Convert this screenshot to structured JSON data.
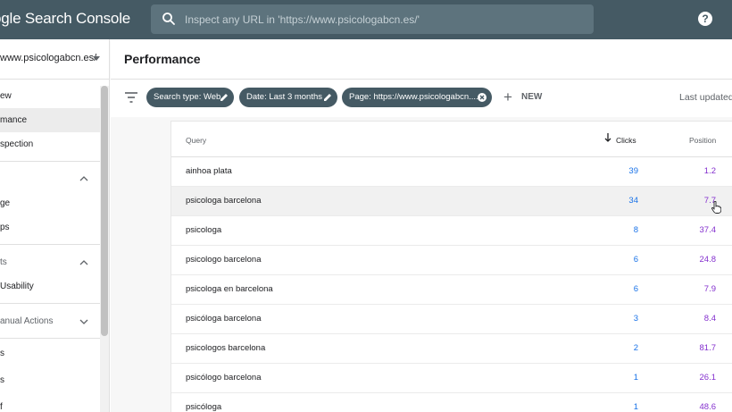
{
  "app": {
    "logo_text": "ogle Search Console",
    "search_placeholder": "Inspect any URL in 'https://www.psicologabcn.es/'",
    "help_label": "?"
  },
  "sidebar": {
    "property": "www.psicologabcn.es/",
    "items": [
      {
        "label": "ew",
        "active": false
      },
      {
        "label": "mance",
        "active": true
      },
      {
        "label": "spection",
        "active": false
      }
    ],
    "groups": [
      {
        "label": "",
        "chevron": "chevron-up-icon",
        "items": [
          "ge",
          "ps"
        ]
      },
      {
        "label": "ts",
        "chevron": "chevron-up-icon",
        "items": [
          "Usability"
        ]
      },
      {
        "label": "anual Actions",
        "chevron": "chevron-down-icon",
        "items": []
      }
    ],
    "extra_items": [
      "s",
      "s",
      "f"
    ]
  },
  "header": {
    "title": "Performance"
  },
  "filters": {
    "chips": [
      {
        "label": "Search type: Web",
        "icon": "pencil-icon"
      },
      {
        "label": "Date: Last 3 months",
        "icon": "pencil-icon"
      },
      {
        "label": "Page: https://www.psicologabcn....",
        "icon": "close-circle-icon"
      }
    ],
    "new_label": "NEW",
    "last_updated": "Last updated"
  },
  "table": {
    "columns": {
      "query": "Query",
      "clicks": "Clicks",
      "position": "Position"
    },
    "rows": [
      {
        "query": "ainhoa plata",
        "clicks": "39",
        "position": "1.2"
      },
      {
        "query": "psicologa barcelona",
        "clicks": "34",
        "position": "7.7"
      },
      {
        "query": "psicologa",
        "clicks": "8",
        "position": "37.4"
      },
      {
        "query": "psicologo barcelona",
        "clicks": "6",
        "position": "24.8"
      },
      {
        "query": "psicologa en barcelona",
        "clicks": "6",
        "position": "7.9"
      },
      {
        "query": "psicóloga barcelona",
        "clicks": "3",
        "position": "8.4"
      },
      {
        "query": "psicologos barcelona",
        "clicks": "2",
        "position": "81.7"
      },
      {
        "query": "psicólogo barcelona",
        "clicks": "1",
        "position": "26.1"
      },
      {
        "query": "psicóloga",
        "clicks": "1",
        "position": "48.6"
      }
    ]
  },
  "colors": {
    "topbar": "#455a64",
    "clicks": "#1a73e8",
    "position": "#8430ce"
  }
}
